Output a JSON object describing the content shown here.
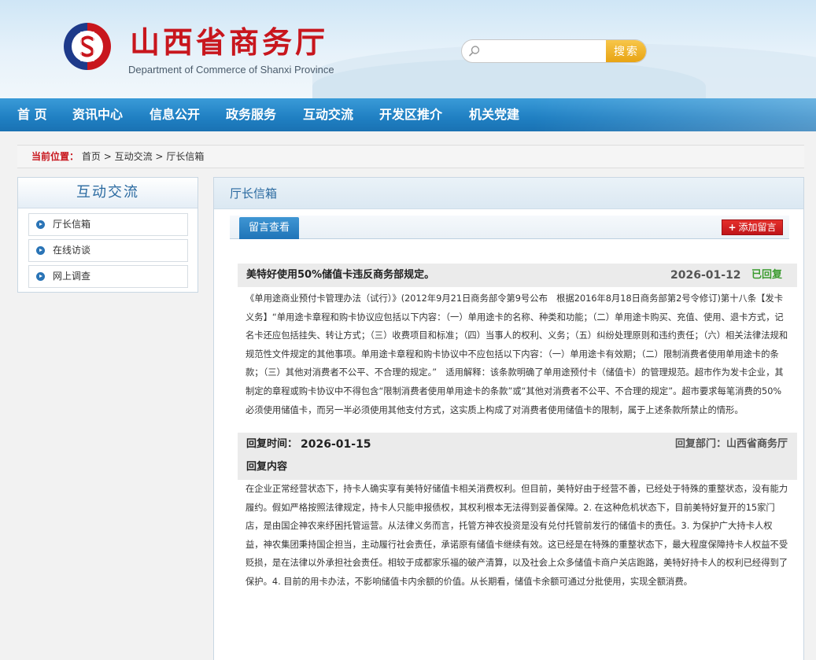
{
  "site": {
    "title": "山西省商务厅",
    "subtitle": "Department of Commerce of Shanxi Province"
  },
  "search": {
    "placeholder": "",
    "button": "搜索"
  },
  "nav": {
    "items": [
      "首 页",
      "资讯中心",
      "信息公开",
      "政务服务",
      "互动交流",
      "开发区推介",
      "机关党建"
    ]
  },
  "breadcrumb": {
    "label": "当前位置：",
    "items": [
      "首页",
      "互动交流",
      "厅长信箱"
    ],
    "separator": ">"
  },
  "sidebar": {
    "title": "互动交流",
    "items": [
      "厅长信箱",
      "在线访谈",
      "网上调查"
    ]
  },
  "main": {
    "title": "厅长信箱",
    "tab": "留言查看",
    "add_button": "添加留言",
    "add_icon": "+"
  },
  "message": {
    "title": "美特好使用50%储值卡违反商务部规定。",
    "date": "2026-01-12",
    "status": "已回复",
    "body": "《单用途商业预付卡管理办法（试行）》(2012年9月21日商务部令第9号公布　根据2016年8月18日商务部第2号令修订)第十八条【发卡义务】“单用途卡章程和购卡协议应包括以下内容：（一）单用途卡的名称、种类和功能；（二）单用途卡购买、充值、使用、退卡方式，记名卡还应包括挂失、转让方式；（三）收费项目和标准；（四）当事人的权利、义务；（五）纠纷处理原则和违约责任；（六）相关法律法规和规范性文件规定的其他事项。单用途卡章程和购卡协议中不应包括以下内容：（一）单用途卡有效期；（二）限制消费者使用单用途卡的条款；（三）其他对消费者不公平、不合理的规定。”　适用解释：该条款明确了单用途预付卡（储值卡）的管理规范。超市作为发卡企业，其制定的章程或购卡协议中不得包含“限制消费者使用单用途卡的条款”或“其他对消费者不公平、不合理的规定”。超市要求每笔消费的50%必须使用储值卡，而另一半必须使用其他支付方式，这实质上构成了对消费者使用储值卡的限制，属于上述条款所禁止的情形。"
  },
  "reply": {
    "time_label": "回复时间：",
    "time": "2026-01-15",
    "dept_label": "回复部门：",
    "dept": "山西省商务厅",
    "content_label": "回复内容",
    "body": "在企业正常经营状态下，持卡人确实享有美特好储值卡相关消费权利。但目前，美特好由于经营不善，已经处于特殊的重整状态，没有能力履约。假如严格按照法律规定，持卡人只能申报债权，其权利根本无法得到妥善保障。2. 在这种危机状态下，目前美特好复开的15家门店，是由国企神农来纾困托管运营。从法律义务而言，托管方神农投资是没有兑付托管前发行的储值卡的责任。3. 为保护广大持卡人权益，神农集团秉持国企担当，主动履行社会责任，承诺原有储值卡继续有效。这已经是在特殊的重整状态下，最大程度保障持卡人权益不受贬损，是在法律以外承担社会责任。相较于成都家乐福的破产清算，以及社会上众多储值卡商户关店跑路，美特好持卡人的权利已经得到了保护。4. 目前的用卡办法，不影响储值卡内余额的价值。从长期看，储值卡余额可通过分批使用，实现全额消费。"
  },
  "colors": {
    "brand_red": "#c8161d",
    "nav_blue": "#1f7fc2",
    "replied_green": "#3b9b2f",
    "search_orange": "#e8a413"
  }
}
